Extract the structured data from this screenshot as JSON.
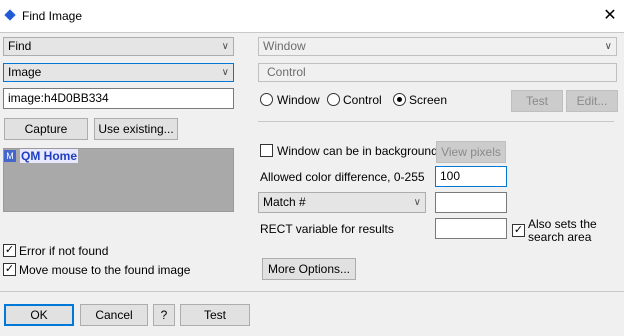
{
  "window": {
    "title": "Find Image",
    "close_glyph": "✕"
  },
  "left": {
    "find_combo": "Find",
    "image_combo": "Image",
    "image_field": "image:h4D0BB334",
    "capture_button": "Capture",
    "use_existing_button": "Use existing...",
    "preview": {
      "icon_label": "M",
      "text": "QM Home"
    },
    "error_if_not_found": {
      "label": "Error if not found",
      "checked": true
    },
    "move_mouse": {
      "label": "Move mouse to the found image",
      "checked": true
    }
  },
  "right": {
    "window_combo": "Window",
    "control_field": "Control",
    "radios": {
      "window": "Window",
      "control": "Control",
      "screen": "Screen",
      "selected": "screen"
    },
    "test_button": "Test",
    "edit_button": "Edit...",
    "window_bg": {
      "label": "Window can be in background",
      "checked": false
    },
    "view_pixels_button": "View pixels",
    "color_diff_label": "Allowed color difference, 0-255",
    "color_diff_value": "100",
    "match_combo": "Match #",
    "rect_label": "RECT variable for results",
    "also_sets": {
      "label": "Also sets the search area",
      "checked": true
    },
    "more_options_button": "More Options..."
  },
  "footer": {
    "ok": "OK",
    "cancel": "Cancel",
    "help": "?",
    "test": "Test"
  },
  "colors": {
    "preview_bg": "#a9a9a9",
    "accent": "#0078d7",
    "preview_text": "#1f3fbf"
  },
  "check_glyph": "✓"
}
